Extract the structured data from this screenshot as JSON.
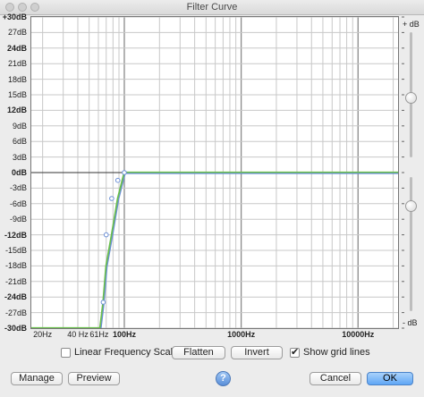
{
  "window": {
    "title": "Filter Curve"
  },
  "db_axis": {
    "labels": [
      "+30dB",
      "27dB",
      "24dB",
      "21dB",
      "18dB",
      "15dB",
      "12dB",
      "9dB",
      "6dB",
      "3dB",
      "0dB",
      "-3dB",
      "-6dB",
      "-9dB",
      "-12dB",
      "-15dB",
      "-18dB",
      "-21dB",
      "-24dB",
      "-27dB",
      "-30dB"
    ],
    "bold": [
      "0dB",
      "12dB",
      "-12dB",
      "-24dB",
      "-30dB",
      "24dB",
      "+30dB"
    ]
  },
  "freq_axis": {
    "labels": [
      "20Hz",
      "40 Hz",
      "61Hz",
      "100Hz",
      "1000Hz",
      "10000Hz"
    ],
    "min_hz": 16,
    "max_hz": 22000
  },
  "gain_slider": {
    "plus_label": "+ dB",
    "minus_label": "- dB"
  },
  "curve": {
    "points_hz": [
      16,
      62,
      66,
      70,
      78,
      88,
      100,
      22000
    ],
    "points_db": [
      -30,
      -30,
      -25,
      -18,
      -12,
      -5,
      0,
      0
    ],
    "control_points_hz": [
      66,
      70,
      78,
      88,
      100
    ],
    "control_points_db": [
      -25,
      -12,
      -5,
      -1.5,
      0
    ]
  },
  "colors": {
    "curve_green": "#6abf4b",
    "curve_blue": "#6b8fd6",
    "grid": "#c8c8c8",
    "primary_button": "#5fa6f5"
  },
  "options": {
    "linear_scale_label": "Linear Frequency Scale",
    "linear_scale_checked": false,
    "grid_label": "Show grid lines",
    "grid_checked": true
  },
  "buttons": {
    "flatten": "Flatten",
    "invert": "Invert",
    "manage": "Manage",
    "preview": "Preview",
    "cancel": "Cancel",
    "ok": "OK",
    "help": "?"
  }
}
